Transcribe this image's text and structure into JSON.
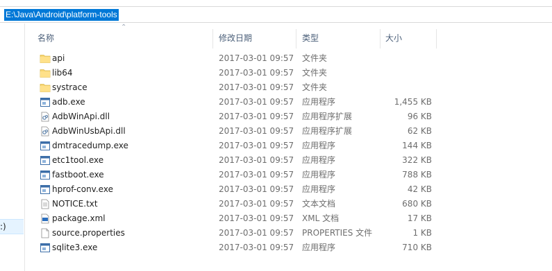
{
  "address": {
    "path": "E:\\Java\\Android\\platform-tools"
  },
  "nav": {
    "selected_label": ":)"
  },
  "columns": {
    "name": "名称",
    "date": "修改日期",
    "type": "类型",
    "size": "大小"
  },
  "files": [
    {
      "icon": "folder-icon",
      "name": "api",
      "date": "2017-03-01 09:57",
      "type": "文件夹",
      "size": ""
    },
    {
      "icon": "folder-icon",
      "name": "lib64",
      "date": "2017-03-01 09:57",
      "type": "文件夹",
      "size": ""
    },
    {
      "icon": "folder-icon",
      "name": "systrace",
      "date": "2017-03-01 09:57",
      "type": "文件夹",
      "size": ""
    },
    {
      "icon": "exe-icon",
      "name": "adb.exe",
      "date": "2017-03-01 09:57",
      "type": "应用程序",
      "size": "1,455 KB"
    },
    {
      "icon": "dll-icon",
      "name": "AdbWinApi.dll",
      "date": "2017-03-01 09:57",
      "type": "应用程序扩展",
      "size": "96 KB"
    },
    {
      "icon": "dll-icon",
      "name": "AdbWinUsbApi.dll",
      "date": "2017-03-01 09:57",
      "type": "应用程序扩展",
      "size": "62 KB"
    },
    {
      "icon": "exe-icon",
      "name": "dmtracedump.exe",
      "date": "2017-03-01 09:57",
      "type": "应用程序",
      "size": "144 KB"
    },
    {
      "icon": "exe-icon",
      "name": "etc1tool.exe",
      "date": "2017-03-01 09:57",
      "type": "应用程序",
      "size": "322 KB"
    },
    {
      "icon": "exe-icon",
      "name": "fastboot.exe",
      "date": "2017-03-01 09:57",
      "type": "应用程序",
      "size": "788 KB"
    },
    {
      "icon": "exe-icon",
      "name": "hprof-conv.exe",
      "date": "2017-03-01 09:57",
      "type": "应用程序",
      "size": "42 KB"
    },
    {
      "icon": "text-file-icon",
      "name": "NOTICE.txt",
      "date": "2017-03-01 09:57",
      "type": "文本文档",
      "size": "680 KB"
    },
    {
      "icon": "xml-file-icon",
      "name": "package.xml",
      "date": "2017-03-01 09:57",
      "type": "XML 文档",
      "size": "17 KB"
    },
    {
      "icon": "generic-file-icon",
      "name": "source.properties",
      "date": "2017-03-01 09:57",
      "type": "PROPERTIES 文件",
      "size": "1 KB"
    },
    {
      "icon": "exe-icon",
      "name": "sqlite3.exe",
      "date": "2017-03-01 09:57",
      "type": "应用程序",
      "size": "710 KB"
    }
  ]
}
